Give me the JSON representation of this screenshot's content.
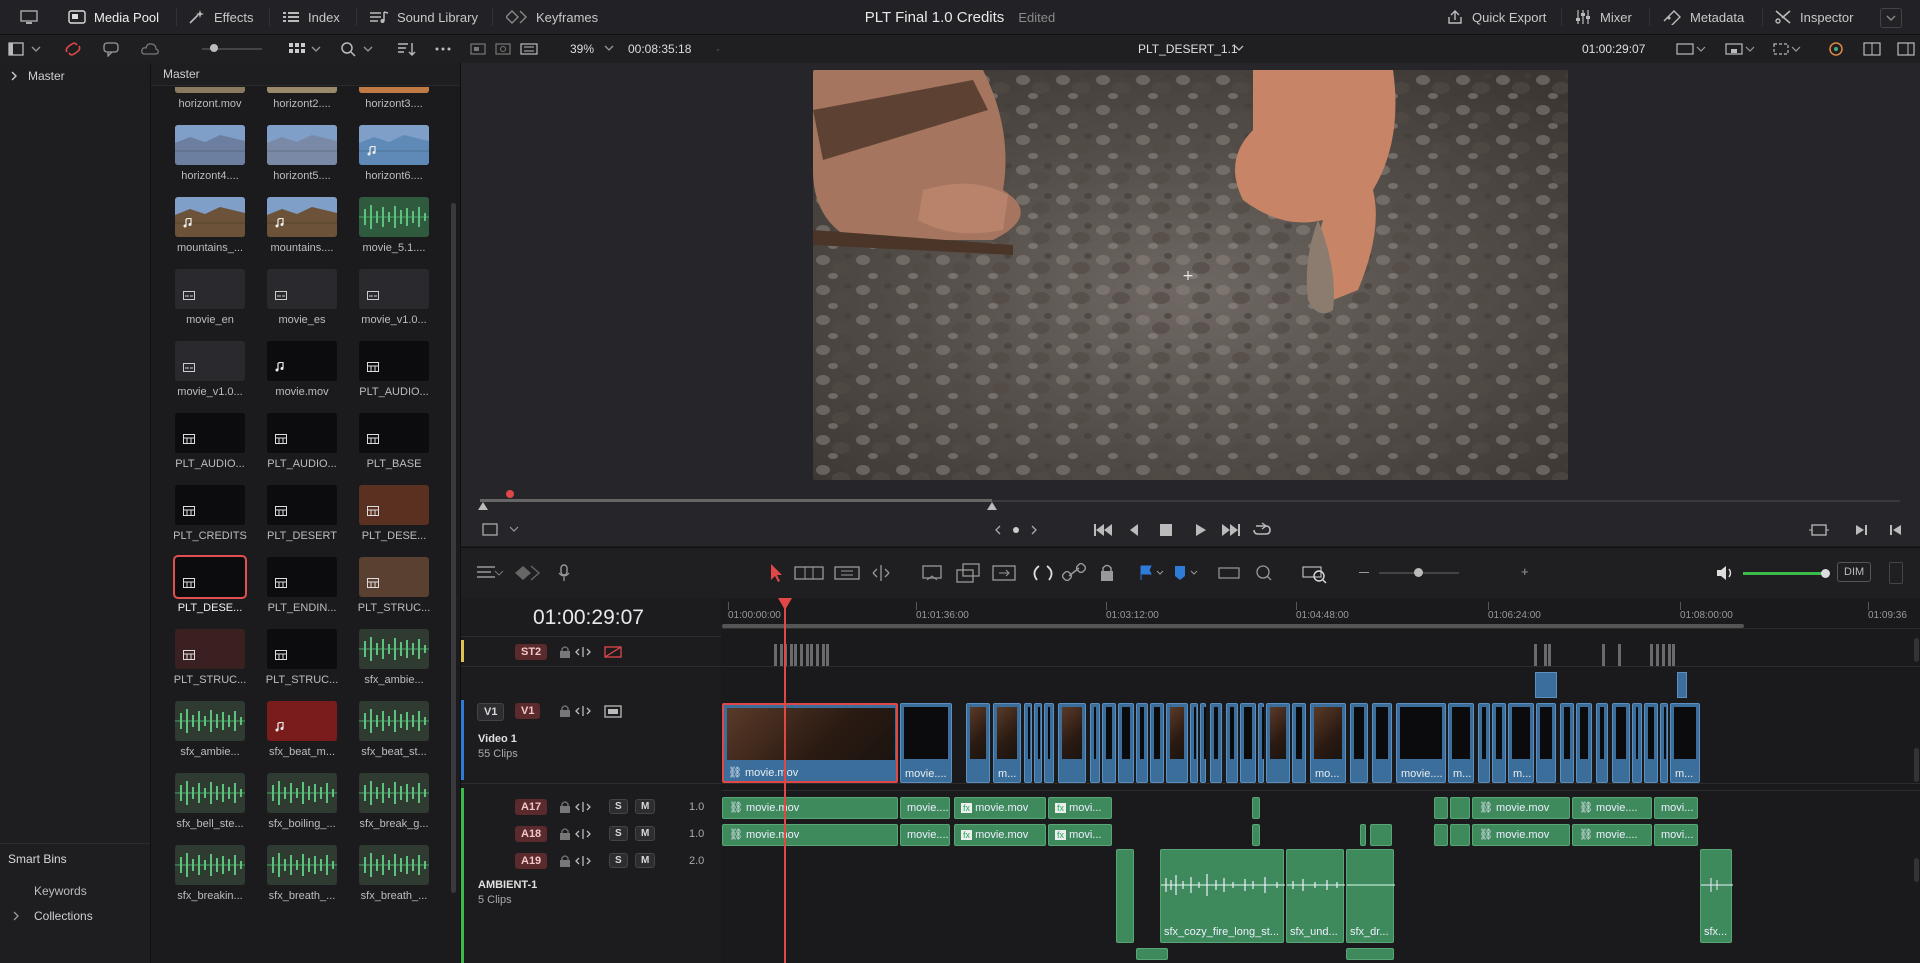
{
  "topbar": {
    "media_pool": "Media Pool",
    "effects": "Effects",
    "index": "Index",
    "sound_library": "Sound Library",
    "keyframes": "Keyframes",
    "project_title": "PLT Final 1.0 Credits",
    "project_status": "Edited",
    "quick_export": "Quick Export",
    "mixer": "Mixer",
    "metadata": "Metadata",
    "inspector": "Inspector"
  },
  "viewerbar": {
    "zoom": "39%",
    "source_timecode": "00:08:35:18",
    "clip_name": "PLT_DESERT_1.1",
    "record_timecode": "01:00:29:07"
  },
  "bins": {
    "master": "Master",
    "smart_bins": "Smart Bins",
    "keywords": "Keywords",
    "collections": "Collections"
  },
  "pool": {
    "header": "Master",
    "clips": [
      {
        "name": "horizont.mov",
        "kind": "video",
        "color": "#8a7a60"
      },
      {
        "name": "horizont2....",
        "kind": "video",
        "color": "#9a8a6a"
      },
      {
        "name": "horizont3....",
        "kind": "audiovideo",
        "color": "#c07b45"
      },
      {
        "name": "horizont4....",
        "kind": "video",
        "color": "#6d7fa0"
      },
      {
        "name": "horizont5....",
        "kind": "video",
        "color": "#7a8aa6"
      },
      {
        "name": "horizont6....",
        "kind": "audiovideo",
        "color": "#5f8ab8"
      },
      {
        "name": "mountains_...",
        "kind": "audiovideo",
        "color": "#6b5238"
      },
      {
        "name": "mountains....",
        "kind": "audiovideo",
        "color": "#6b5238"
      },
      {
        "name": "movie_5.1....",
        "kind": "waveform",
        "color": "#2f5a3e"
      },
      {
        "name": "movie_en",
        "kind": "subtitle",
        "color": "#2a2a2e"
      },
      {
        "name": "movie_es",
        "kind": "subtitle",
        "color": "#2a2a2e"
      },
      {
        "name": "movie_v1.0...",
        "kind": "subtitle",
        "color": "#2a2a2e"
      },
      {
        "name": "movie_v1.0...",
        "kind": "subtitle",
        "color": "#2a2a2e"
      },
      {
        "name": "movie.mov",
        "kind": "audio",
        "color": "#0c0c0e"
      },
      {
        "name": "PLT_AUDIO...",
        "kind": "timeline",
        "color": "#0c0c0e"
      },
      {
        "name": "PLT_AUDIO...",
        "kind": "timeline",
        "color": "#0c0c0e"
      },
      {
        "name": "PLT_AUDIO...",
        "kind": "timeline",
        "color": "#0c0c0e"
      },
      {
        "name": "PLT_BASE",
        "kind": "timeline",
        "color": "#0c0c0e"
      },
      {
        "name": "PLT_CREDITS",
        "kind": "timeline",
        "color": "#0c0c0e"
      },
      {
        "name": "PLT_DESERT",
        "kind": "timeline",
        "color": "#0c0c0e"
      },
      {
        "name": "PLT_DESE...",
        "kind": "timeline",
        "color": "#5a3020"
      },
      {
        "name": "PLT_DESE...",
        "kind": "timeline",
        "color": "#0c0c0e",
        "selected": true
      },
      {
        "name": "PLT_ENDIN...",
        "kind": "timeline",
        "color": "#0c0c0e"
      },
      {
        "name": "PLT_STRUC...",
        "kind": "timeline",
        "color": "#5a4030"
      },
      {
        "name": "PLT_STRUC...",
        "kind": "timeline",
        "color": "#3a2020"
      },
      {
        "name": "PLT_STRUC...",
        "kind": "timeline",
        "color": "#0c0c0e"
      },
      {
        "name": "sfx_ambie...",
        "kind": "waveform",
        "color": "#2f3a30"
      },
      {
        "name": "sfx_ambie...",
        "kind": "waveform",
        "color": "#2f3a30"
      },
      {
        "name": "sfx_beat_m...",
        "kind": "audio",
        "color": "#7a1c1c"
      },
      {
        "name": "sfx_beat_st...",
        "kind": "waveform",
        "color": "#2f3a30"
      },
      {
        "name": "sfx_bell_ste...",
        "kind": "waveform",
        "color": "#2f3a30"
      },
      {
        "name": "sfx_boiling_...",
        "kind": "waveform",
        "color": "#2f3a30"
      },
      {
        "name": "sfx_break_g...",
        "kind": "waveform",
        "color": "#2f3a30"
      },
      {
        "name": "sfx_breakin...",
        "kind": "waveform",
        "color": "#2f3a30"
      },
      {
        "name": "sfx_breath_...",
        "kind": "waveform",
        "color": "#2f3a30"
      },
      {
        "name": "sfx_breath_...",
        "kind": "waveform",
        "color": "#2f3a30"
      }
    ]
  },
  "timeline": {
    "timecode": "01:00:29:07",
    "ruler": [
      "01:00:00:00",
      "01:01:36:00",
      "01:03:12:00",
      "01:04:48:00",
      "01:06:24:00",
      "01:08:00:00",
      "01:09:36"
    ],
    "tracks": {
      "st2": "ST2",
      "v1_dest": "V1",
      "v1": "V1",
      "video1_name": "Video 1",
      "video1_count": "55 Clips",
      "a17": "A17",
      "a18": "A18",
      "a19": "A19",
      "a17_level": "1.0",
      "a18_level": "1.0",
      "a19_level": "2.0",
      "s": "S",
      "m": "M",
      "ambient_name": "AMBIENT-1",
      "ambient_count": "5 Clips"
    },
    "clips": {
      "v_first": "movie.mov",
      "v_second": "movie....",
      "v_third": "m...",
      "v_mo": "mo...",
      "v_movie": "movie....",
      "v_m1": "m...",
      "v_m2": "m...",
      "v_last": "m...",
      "a_movie": "movie.mov",
      "a_movie_short": "movie....",
      "a_fx_movie": "movie.mov",
      "a_movi": "movi...",
      "a_right_movie": "movie.mov",
      "a_right_movie2": "movie....",
      "a_right_movi": "movi...",
      "sfx_cozy": "sfx_cozy_fire_long_st...",
      "sfx_und": "sfx_und...",
      "sfx_dr": "sfx_dr...",
      "sfx_end": "sfx..."
    },
    "dim": "DIM"
  }
}
